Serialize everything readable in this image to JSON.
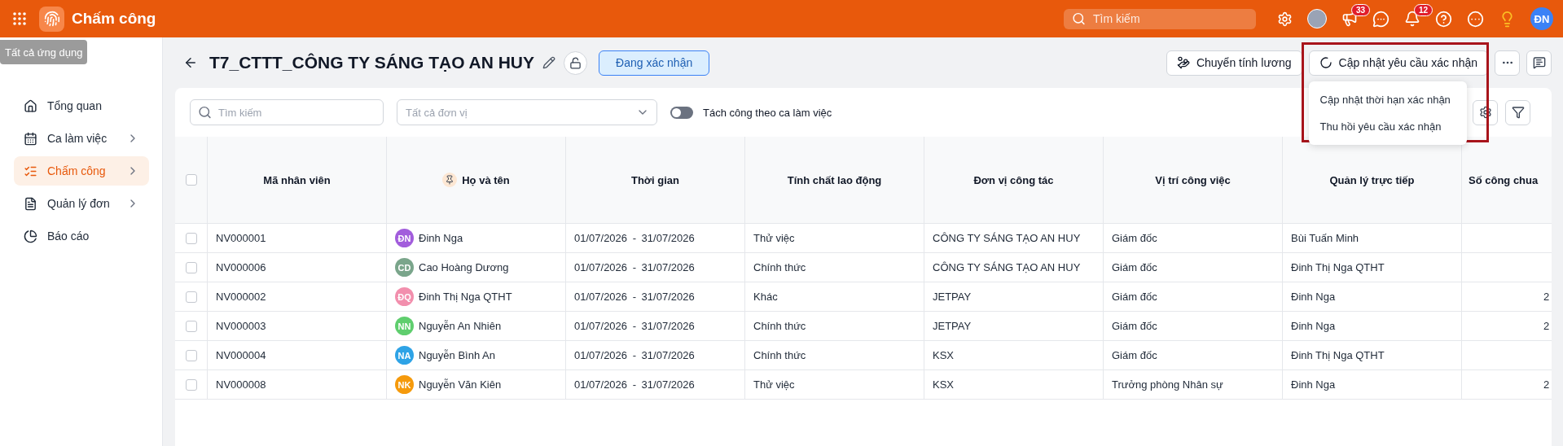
{
  "header": {
    "app_title": "Chấm công",
    "search": {
      "placeholder": "Tìm kiếm"
    },
    "announcements_badge": "33",
    "notifications_badge": "12",
    "user_initials": "ĐN"
  },
  "tooltip": "Tất cả ứng dụng",
  "sidebar": {
    "items": [
      {
        "kind": "home",
        "label": "Tổng quan",
        "has_submenu": false,
        "selected": false
      },
      {
        "kind": "calendar",
        "label": "Ca làm việc",
        "has_submenu": true,
        "selected": false
      },
      {
        "kind": "checklist",
        "label": "Chấm công",
        "has_submenu": true,
        "selected": true
      },
      {
        "kind": "document",
        "label": "Quản lý đơn",
        "has_submenu": true,
        "selected": false
      },
      {
        "kind": "chart",
        "label": "Báo cáo",
        "has_submenu": false,
        "selected": false
      }
    ]
  },
  "page": {
    "title": "T7_CTTT_CÔNG TY SÁNG TẠO AN HUY",
    "status": "Đang xác nhận",
    "actions": {
      "payroll": "Chuyển tính lương",
      "update": "Cập nhật yêu cầu xác nhận"
    },
    "update_menu": {
      "open": true,
      "items": [
        "Cập nhật thời hạn xác nhận",
        "Thu hồi yêu cầu xác nhận"
      ]
    }
  },
  "toolbar": {
    "search": {
      "placeholder": "Tìm kiếm"
    },
    "unit_select": {
      "placeholder": "Tất cả đơn vị"
    },
    "split_by_shift": {
      "on": false,
      "label": "Tách công theo ca làm việc"
    }
  },
  "table": {
    "select_all_checked": false,
    "columns": [
      "Mã nhân viên",
      "Họ và tên",
      "Thời gian",
      "Tính chất lao động",
      "Đơn vị công tác",
      "Vị trí công việc",
      "Quản lý trực tiếp",
      "Số công chua"
    ],
    "rows": [
      {
        "checked": false,
        "id": "NV000001",
        "initials": "ĐN",
        "color": "#a25ddc",
        "name": "Đinh Nga",
        "period": "01/07/2026 - 31/07/2026",
        "type": "Thử việc",
        "unit": "CÔNG TY SÁNG TẠO AN HUY",
        "position": "Giám đốc",
        "manager": "Bùi Tuấn Minh"
      },
      {
        "checked": false,
        "id": "NV000006",
        "initials": "CD",
        "color": "#7aa58b",
        "name": "Cao Hoàng Dương",
        "period": "01/07/2026 - 31/07/2026",
        "type": "Chính thức",
        "unit": "CÔNG TY SÁNG TẠO AN HUY",
        "position": "Giám đốc",
        "manager": "Đinh Thị Nga QTHT"
      },
      {
        "checked": false,
        "id": "NV000002",
        "initials": "ĐQ",
        "color": "#f28fad",
        "name": "Đinh Thị Nga QTHT",
        "period": "01/07/2026 - 31/07/2026",
        "type": "Khác",
        "unit": "JETPAY",
        "position": "Giám đốc",
        "manager": "Đinh Nga",
        "column_8": "2"
      },
      {
        "checked": false,
        "id": "NV000003",
        "initials": "NN",
        "color": "#5fce6e",
        "name": "Nguyễn An Nhiên",
        "period": "01/07/2026 - 31/07/2026",
        "type": "Chính thức",
        "unit": "JETPAY",
        "position": "Giám đốc",
        "manager": "Đinh Nga",
        "column_8": "2"
      },
      {
        "checked": false,
        "id": "NV000004",
        "initials": "NA",
        "color": "#2ea3e6",
        "name": "Nguyễn Bình An",
        "period": "01/07/2026 - 31/07/2026",
        "type": "Chính thức",
        "unit": "KSX",
        "position": "Giám đốc",
        "manager": "Đinh Thị Nga QTHT"
      },
      {
        "checked": false,
        "id": "NV000008",
        "initials": "NK",
        "color": "#f59a0c",
        "name": "Nguyễn Văn Kiên",
        "period": "01/07/2026 - 31/07/2026",
        "type": "Thử việc",
        "unit": "KSX",
        "position": "Trưởng phòng Nhân sự",
        "manager": "Đinh Nga",
        "column_8": "2"
      }
    ]
  }
}
